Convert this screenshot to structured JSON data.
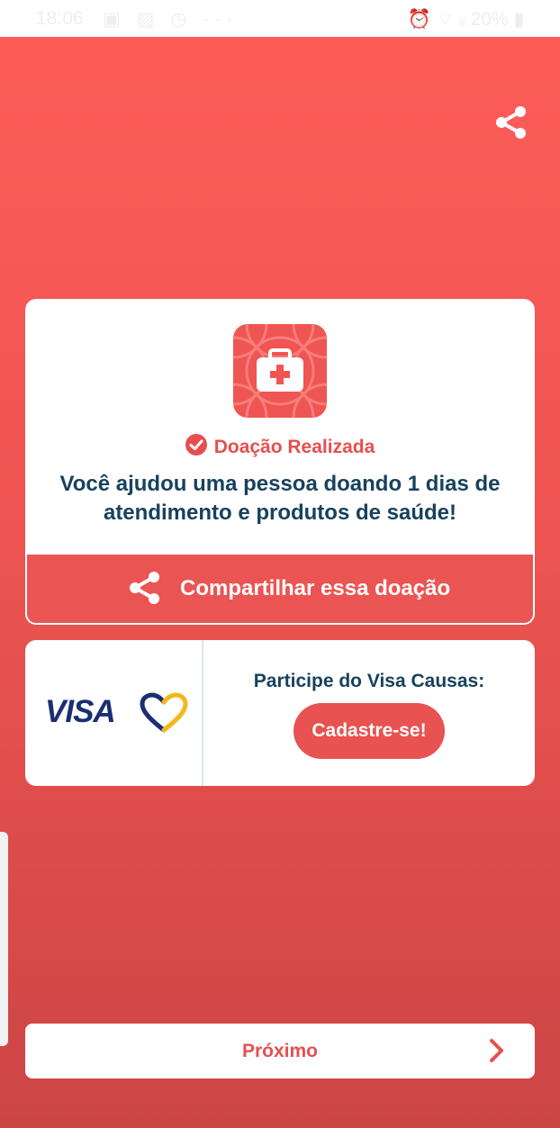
{
  "status_bar": {
    "time": "18:06",
    "icons_left": "▣ ▨ ◷ ···",
    "icons_right": "⏰ ⌔ ᵢᵢ 20% ▮"
  },
  "header": {
    "share_icon": "share-icon"
  },
  "donation_card": {
    "tile_icon": "medical-kit-icon",
    "status": "Doação Realizada",
    "message": "Você ajudou uma pessoa doando 1 dias de atendimento e produtos de saúde!",
    "share_label": "Compartilhar essa doação"
  },
  "visa_card": {
    "brand": "VISA",
    "title": "Participe do Visa Causas:",
    "cta": "Cadastre-se!"
  },
  "footer": {
    "next_label": "Próximo"
  },
  "colors": {
    "accent": "#e5504f",
    "text_dark": "#17425d",
    "visa_blue": "#1a2f72",
    "visa_gold": "#f3b81a"
  }
}
